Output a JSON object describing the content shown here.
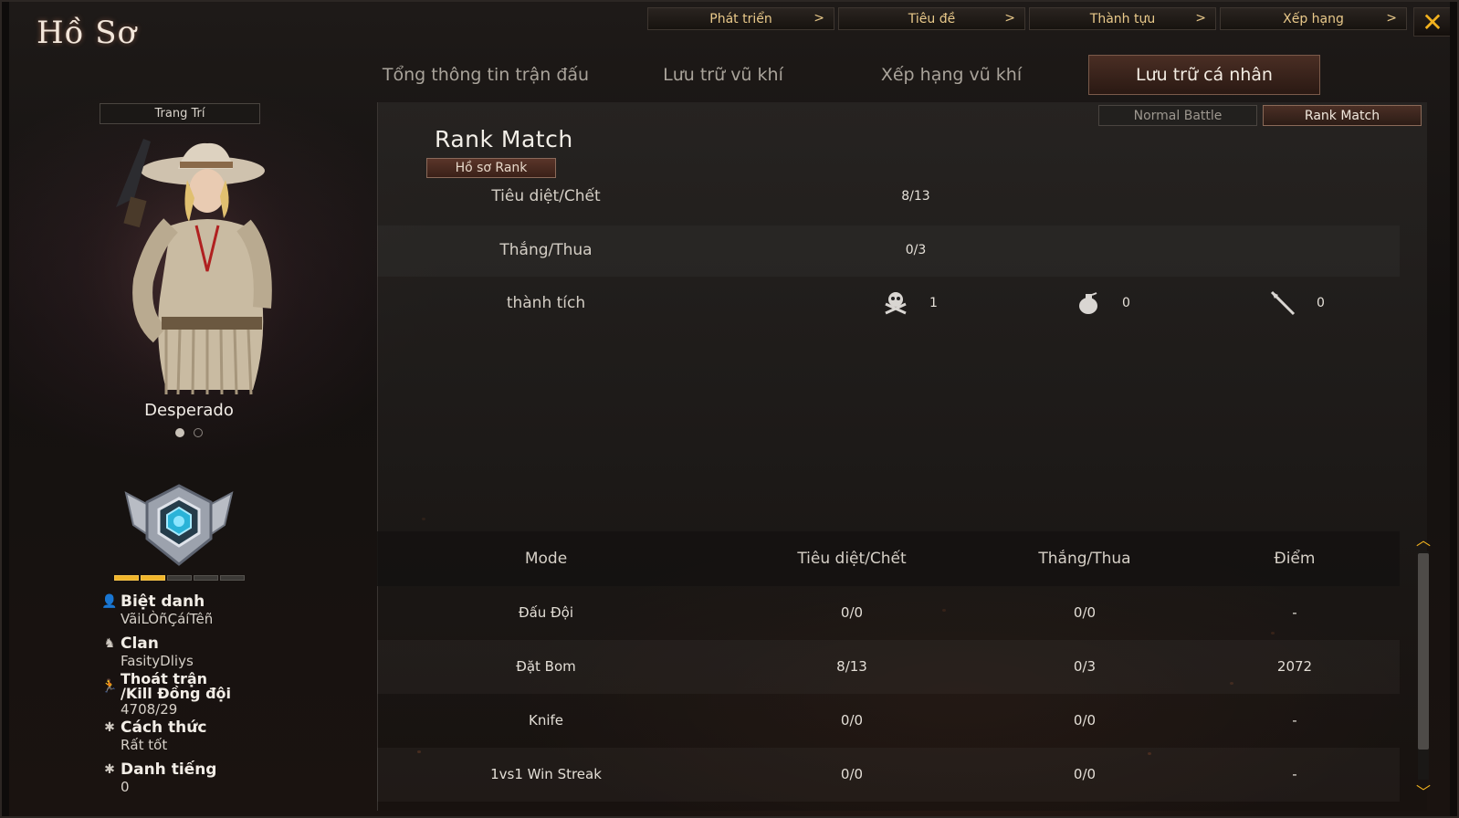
{
  "title": "Hồ Sơ",
  "top_buttons": [
    {
      "label": "Phát triển",
      "arrow": ">"
    },
    {
      "label": "Tiêu đề",
      "arrow": ">"
    },
    {
      "label": "Thành tựu",
      "arrow": ">"
    },
    {
      "label": "Xếp hạng",
      "arrow": ">"
    }
  ],
  "close_label": "✕",
  "tabs": [
    {
      "label": "Tổng thông tin trận đấu",
      "active": false
    },
    {
      "label": "Lưu trữ vũ khí",
      "active": false
    },
    {
      "label": "Xếp hạng vũ khí",
      "active": false
    },
    {
      "label": "Lưu trữ cá nhân",
      "active": true
    }
  ],
  "left_panel": {
    "decorate_button": "Trang Trí",
    "character_name": "Desperado",
    "carousel_active_index": 0,
    "rank_progress_filled": 2,
    "rank_progress_total": 5,
    "info": [
      {
        "icon": "person-icon",
        "label": "Biệt danh",
        "value": "VãiLÒñÇáíTêñ"
      },
      {
        "icon": "clan-icon",
        "label": "Clan",
        "value": "FasityDliys"
      },
      {
        "icon": "runner-icon",
        "label": "Thoát trận /Kill Đồng đội",
        "value": "4708/29"
      },
      {
        "icon": "gear-icon",
        "label": "Cách thức",
        "value": "Rất tốt"
      },
      {
        "icon": "gear-icon",
        "label": "Danh tiếng",
        "value": "0"
      }
    ]
  },
  "mode_buttons": [
    {
      "label": "Normal Battle",
      "active": false
    },
    {
      "label": "Rank Match",
      "active": true
    }
  ],
  "rank_section": {
    "title": "Rank Match",
    "profile_button": "Hồ sơ Rank",
    "kd_label": "Tiêu diệt/Chết",
    "kd_value": "8/13",
    "wl_label": "Thắng/Thua",
    "wl_value": "0/3",
    "achievement_label": "thành tích",
    "achievements": [
      {
        "icon": "skull-crossbones-icon",
        "value": "1"
      },
      {
        "icon": "grenade-icon",
        "value": "0"
      },
      {
        "icon": "knife-icon",
        "value": "0"
      }
    ]
  },
  "table": {
    "headers": [
      "Mode",
      "Tiêu diệt/Chết",
      "Thắng/Thua",
      "Điểm"
    ],
    "rows": [
      [
        "Đấu Đội",
        "0/0",
        "0/0",
        "-"
      ],
      [
        "Đặt Bom",
        "8/13",
        "0/3",
        "2072"
      ],
      [
        "Knife",
        "0/0",
        "0/0",
        "-"
      ],
      [
        "1vs1 Win Streak",
        "0/0",
        "0/0",
        "-"
      ]
    ]
  },
  "colors": {
    "accent_gold": "#f2b21f",
    "active_tab": "#4a2e24"
  }
}
